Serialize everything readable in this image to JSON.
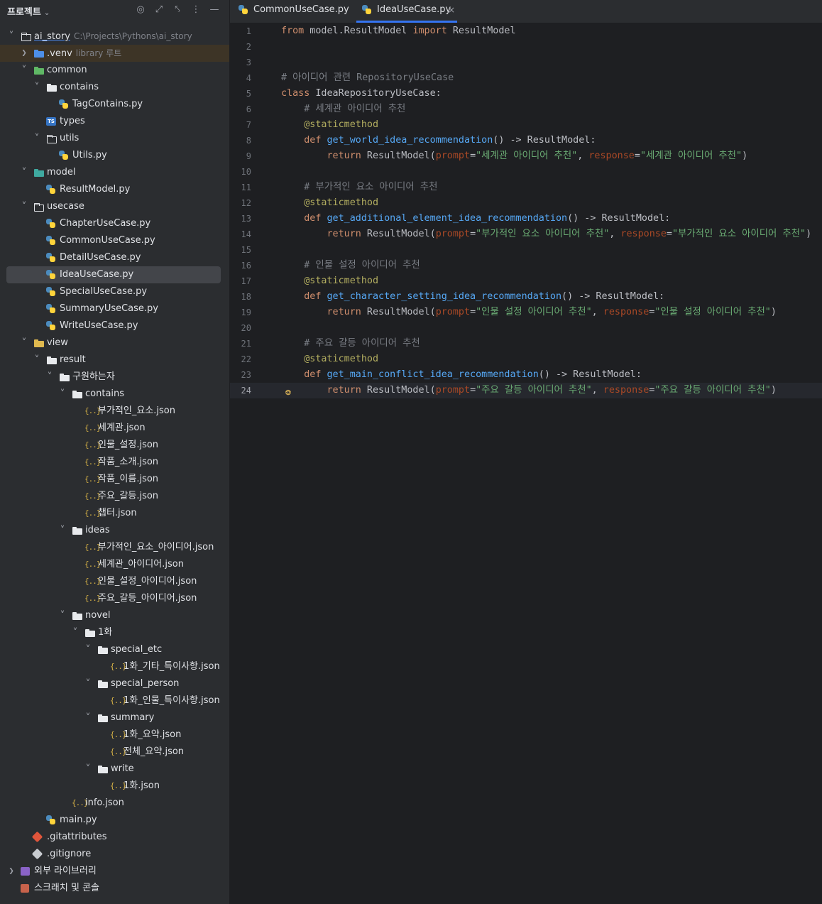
{
  "project_header": {
    "title": "프로젝트",
    "icons": [
      "locate-icon",
      "expand-all-icon",
      "collapse-all-icon",
      "more-options-icon",
      "minimize-icon"
    ]
  },
  "tree": [
    {
      "label": "ai_story",
      "hint": "C:\\Projects\\Pythons\\ai_story",
      "icon": "folder-outline",
      "arrow": "down",
      "indent": 0,
      "root": true
    },
    {
      "label": ".venv",
      "hint": "library 루트",
      "icon": "folder-blue",
      "arrow": "right",
      "indent": 1,
      "venv": true
    },
    {
      "label": "common",
      "icon": "folder-green",
      "arrow": "down",
      "indent": 1
    },
    {
      "label": "contains",
      "icon": "folder",
      "arrow": "down",
      "indent": 2
    },
    {
      "label": "TagContains.py",
      "icon": "python",
      "indent": 3
    },
    {
      "label": "types",
      "icon": "typescript",
      "indent": 2
    },
    {
      "label": "utils",
      "icon": "folder-outline",
      "arrow": "down",
      "indent": 2
    },
    {
      "label": "Utils.py",
      "icon": "python",
      "indent": 3
    },
    {
      "label": "model",
      "icon": "folder-teal",
      "arrow": "down",
      "indent": 1
    },
    {
      "label": "ResultModel.py",
      "icon": "python",
      "indent": 2
    },
    {
      "label": "usecase",
      "icon": "folder-outline",
      "arrow": "down",
      "indent": 1
    },
    {
      "label": "ChapterUseCase.py",
      "icon": "python",
      "indent": 2
    },
    {
      "label": "CommonUseCase.py",
      "icon": "python",
      "indent": 2
    },
    {
      "label": "DetailUseCase.py",
      "icon": "python",
      "indent": 2
    },
    {
      "label": "IdeaUseCase.py",
      "icon": "python",
      "indent": 2,
      "selected": true
    },
    {
      "label": "SpecialUseCase.py",
      "icon": "python",
      "indent": 2
    },
    {
      "label": "SummaryUseCase.py",
      "icon": "python",
      "indent": 2
    },
    {
      "label": "WriteUseCase.py",
      "icon": "python",
      "indent": 2
    },
    {
      "label": "view",
      "icon": "folder-yellow",
      "arrow": "down",
      "indent": 1
    },
    {
      "label": "result",
      "icon": "folder",
      "arrow": "down",
      "indent": 2
    },
    {
      "label": "구원하는자",
      "icon": "folder",
      "arrow": "down",
      "indent": 3
    },
    {
      "label": "contains",
      "icon": "folder",
      "arrow": "down",
      "indent": 4
    },
    {
      "label": "부가적인_요소.json",
      "icon": "json",
      "indent": 5
    },
    {
      "label": "세계관.json",
      "icon": "json",
      "indent": 5
    },
    {
      "label": "인물_설정.json",
      "icon": "json",
      "indent": 5
    },
    {
      "label": "작품_소개.json",
      "icon": "json",
      "indent": 5
    },
    {
      "label": "작품_이름.json",
      "icon": "json",
      "indent": 5
    },
    {
      "label": "주요_갈등.json",
      "icon": "json",
      "indent": 5
    },
    {
      "label": "챕터.json",
      "icon": "json",
      "indent": 5
    },
    {
      "label": "ideas",
      "icon": "folder",
      "arrow": "down",
      "indent": 4
    },
    {
      "label": "부가적인_요소_아이디어.json",
      "icon": "json",
      "indent": 5
    },
    {
      "label": "세계관_아이디어.json",
      "icon": "json",
      "indent": 5
    },
    {
      "label": "인물_설정_아이디어.json",
      "icon": "json",
      "indent": 5
    },
    {
      "label": "주요_갈등_아이디어.json",
      "icon": "json",
      "indent": 5
    },
    {
      "label": "novel",
      "icon": "folder",
      "arrow": "down",
      "indent": 4
    },
    {
      "label": "1화",
      "icon": "folder",
      "arrow": "down",
      "indent": 5
    },
    {
      "label": "special_etc",
      "icon": "folder",
      "arrow": "down",
      "indent": 6
    },
    {
      "label": "1화_기타_특이사항.json",
      "icon": "json",
      "indent": 7
    },
    {
      "label": "special_person",
      "icon": "folder",
      "arrow": "down",
      "indent": 6
    },
    {
      "label": "1화_인물_특이사항.json",
      "icon": "json",
      "indent": 7
    },
    {
      "label": "summary",
      "icon": "folder",
      "arrow": "down",
      "indent": 6
    },
    {
      "label": "1화_요약.json",
      "icon": "json",
      "indent": 7
    },
    {
      "label": "전체_요약.json",
      "icon": "json",
      "indent": 7
    },
    {
      "label": "write",
      "icon": "folder",
      "arrow": "down",
      "indent": 6
    },
    {
      "label": "1화.json",
      "icon": "json",
      "indent": 7
    },
    {
      "label": "info.json",
      "icon": "json",
      "indent": 4
    },
    {
      "label": "main.py",
      "icon": "python",
      "indent": 2
    },
    {
      "label": ".gitattributes",
      "icon": "git",
      "indent": 1
    },
    {
      "label": ".gitignore",
      "icon": "gitignore",
      "indent": 1
    },
    {
      "label": "외부 라이브러리",
      "icon": "library",
      "arrow": "right",
      "indent": 0
    },
    {
      "label": "스크래치 및 콘솔",
      "icon": "scratch",
      "indent": 0
    }
  ],
  "tabs": [
    {
      "label": "CommonUseCase.py",
      "active": false
    },
    {
      "label": "IdeaUseCase.py",
      "active": true,
      "close": "×"
    }
  ],
  "editor": {
    "current_line": 24,
    "lines": [
      [
        [
          "kw",
          "from"
        ],
        [
          "plain",
          " model.ResultModel "
        ],
        [
          "kw",
          "import"
        ],
        [
          "plain",
          " ResultModel"
        ]
      ],
      [],
      [],
      [
        [
          "cm",
          "# 아이디어 관련 RepositoryUseCase"
        ]
      ],
      [
        [
          "kw",
          "class"
        ],
        [
          "plain",
          " IdeaRepositoryUseCase:"
        ]
      ],
      [
        [
          "plain",
          "    "
        ],
        [
          "cm",
          "# 세계관 아이디어 추천"
        ]
      ],
      [
        [
          "plain",
          "    "
        ],
        [
          "dec",
          "@staticmethod"
        ]
      ],
      [
        [
          "plain",
          "    "
        ],
        [
          "kw",
          "def"
        ],
        [
          "plain",
          " "
        ],
        [
          "fn",
          "get_world_idea_recommendation"
        ],
        [
          "plain",
          "() -> ResultModel:"
        ]
      ],
      [
        [
          "plain",
          "        "
        ],
        [
          "kw",
          "return"
        ],
        [
          "plain",
          " ResultModel("
        ],
        [
          "param",
          "prompt"
        ],
        [
          "plain",
          "="
        ],
        [
          "str",
          "\"세계관 아이디어 추천\""
        ],
        [
          "plain",
          ", "
        ],
        [
          "param",
          "response"
        ],
        [
          "plain",
          "="
        ],
        [
          "str",
          "\"세계관 아이디어 추천\""
        ],
        [
          "plain",
          ")"
        ]
      ],
      [],
      [
        [
          "plain",
          "    "
        ],
        [
          "cm",
          "# 부가적인 요소 아이디어 추천"
        ]
      ],
      [
        [
          "plain",
          "    "
        ],
        [
          "dec",
          "@staticmethod"
        ]
      ],
      [
        [
          "plain",
          "    "
        ],
        [
          "kw",
          "def"
        ],
        [
          "plain",
          " "
        ],
        [
          "fn",
          "get_additional_element_idea_recommendation"
        ],
        [
          "plain",
          "() -> ResultModel:"
        ]
      ],
      [
        [
          "plain",
          "        "
        ],
        [
          "kw",
          "return"
        ],
        [
          "plain",
          " ResultModel("
        ],
        [
          "param",
          "prompt"
        ],
        [
          "plain",
          "="
        ],
        [
          "str",
          "\"부가적인 요소 아이디어 추천\""
        ],
        [
          "plain",
          ", "
        ],
        [
          "param",
          "response"
        ],
        [
          "plain",
          "="
        ],
        [
          "str",
          "\"부가적인 요소 아이디어 추천\""
        ],
        [
          "plain",
          ")"
        ]
      ],
      [],
      [
        [
          "plain",
          "    "
        ],
        [
          "cm",
          "# 인물 설정 아이디어 추천"
        ]
      ],
      [
        [
          "plain",
          "    "
        ],
        [
          "dec",
          "@staticmethod"
        ]
      ],
      [
        [
          "plain",
          "    "
        ],
        [
          "kw",
          "def"
        ],
        [
          "plain",
          " "
        ],
        [
          "fn",
          "get_character_setting_idea_recommendation"
        ],
        [
          "plain",
          "() -> ResultModel:"
        ]
      ],
      [
        [
          "plain",
          "        "
        ],
        [
          "kw",
          "return"
        ],
        [
          "plain",
          " ResultModel("
        ],
        [
          "param",
          "prompt"
        ],
        [
          "plain",
          "="
        ],
        [
          "str",
          "\"인물 설정 아이디어 추천\""
        ],
        [
          "plain",
          ", "
        ],
        [
          "param",
          "response"
        ],
        [
          "plain",
          "="
        ],
        [
          "str",
          "\"인물 설정 아이디어 추천\""
        ],
        [
          "plain",
          ")"
        ]
      ],
      [],
      [
        [
          "plain",
          "    "
        ],
        [
          "cm",
          "# 주요 갈등 아이디어 추천"
        ]
      ],
      [
        [
          "plain",
          "    "
        ],
        [
          "dec",
          "@staticmethod"
        ]
      ],
      [
        [
          "plain",
          "    "
        ],
        [
          "kw",
          "def"
        ],
        [
          "plain",
          " "
        ],
        [
          "fn",
          "get_main_conflict_idea_recommendation"
        ],
        [
          "plain",
          "() -> ResultModel:"
        ]
      ],
      [
        [
          "plain",
          "        "
        ],
        [
          "kw",
          "return"
        ],
        [
          "plain",
          " ResultModel("
        ],
        [
          "param",
          "prompt"
        ],
        [
          "plain",
          "="
        ],
        [
          "str",
          "\"주요 갈등 아이디어 추천\""
        ],
        [
          "plain",
          ", "
        ],
        [
          "param",
          "response"
        ],
        [
          "plain",
          "="
        ],
        [
          "str",
          "\"주요 갈등 아이디어 추천\""
        ],
        [
          "plain",
          ")"
        ]
      ]
    ]
  }
}
